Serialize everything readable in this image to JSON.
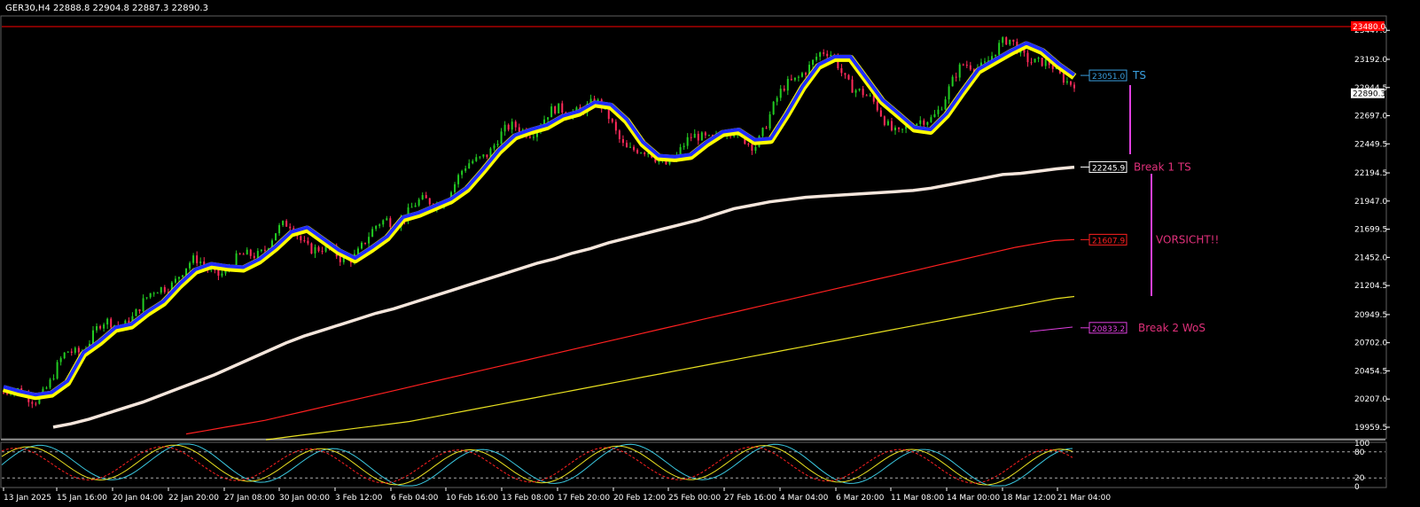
{
  "header": {
    "symbol_line": "GER30,H4  22888.8 22904.8 22887.3 22890.3"
  },
  "price_axis": {
    "ticks": [
      "23447.0",
      "23192.0",
      "22944.5",
      "22697.0",
      "22449.5",
      "22194.5",
      "21947.0",
      "21699.5",
      "21452.0",
      "21204.5",
      "20949.5",
      "20702.0",
      "20454.5",
      "20207.0",
      "19959.5"
    ],
    "current_price": "22890.3",
    "resistance_price": "23480.0"
  },
  "time_axis": {
    "ticks": [
      "13 Jan 2025",
      "15 Jan 16:00",
      "20 Jan 04:00",
      "22 Jan 20:00",
      "27 Jan 08:00",
      "30 Jan 00:00",
      "3 Feb 12:00",
      "6 Feb 04:00",
      "10 Feb 16:00",
      "13 Feb 08:00",
      "17 Feb 20:00",
      "20 Feb 12:00",
      "25 Feb 00:00",
      "27 Feb 16:00",
      "4 Mar 04:00",
      "6 Mar 20:00",
      "11 Mar 08:00",
      "14 Mar 00:00",
      "18 Mar 12:00",
      "21 Mar 04:00"
    ]
  },
  "oscillator_axis": {
    "ticks": [
      "100",
      "80",
      "20",
      "0"
    ]
  },
  "levels": [
    {
      "value": "23051.0",
      "label": "TS",
      "color": "#3aa0e0"
    },
    {
      "value": "22245.9",
      "label": "Break 1 TS",
      "color": "#ffffff",
      "label_color": "#e0307a"
    },
    {
      "value": "21607.9",
      "label": "VORSICHT!!",
      "color": "#ff2020",
      "label_color": "#e0307a"
    },
    {
      "value": "20833.2",
      "label": "Break 2 WoS",
      "color": "#e040e0",
      "label_color": "#e0307a"
    }
  ],
  "colors": {
    "background": "#000000",
    "bull_candle": "#22cc22",
    "bear_candle": "#ff2a5a",
    "ma_fast_outer": "#ffff00",
    "ma_fast_inner": "#1f2cff",
    "ma_mid": "#f5e6dc",
    "ma_slow": "#ff2020",
    "ma_slowest": "#e8e020",
    "resistance": "#ff0000",
    "separator": "#808080"
  },
  "chart_data": {
    "type": "line",
    "title": "GER30,H4",
    "series": [
      {
        "values": [
          20300,
          20260,
          20230,
          20250,
          20350,
          20600,
          20700,
          20820,
          20850,
          20960,
          21050,
          21200,
          21330,
          21380,
          21360,
          21350,
          21420,
          21530,
          21660,
          21700,
          21600,
          21500,
          21430,
          21520,
          21620,
          21790,
          21830,
          21890,
          21950,
          22050,
          22210,
          22380,
          22510,
          22560,
          22600,
          22680,
          22720,
          22800,
          22780,
          22650,
          22450,
          22330,
          22320,
          22340,
          22450,
          22540,
          22560,
          22470,
          22480,
          22700,
          22940,
          23130,
          23200,
          23200,
          23010,
          22820,
          22700,
          22580,
          22560,
          22700,
          22900,
          23090,
          23170,
          23250,
          23320,
          23260,
          23140,
          23040
        ]
      },
      {
        "values": [
          19960,
          19990,
          20030,
          20080,
          20130,
          20180,
          20240,
          20300,
          20360,
          20420,
          20490,
          20560,
          20630,
          20700,
          20760,
          20810,
          20860,
          20910,
          20960,
          21000,
          21050,
          21100,
          21150,
          21200,
          21250,
          21300,
          21350,
          21400,
          21440,
          21490,
          21530,
          21580,
          21620,
          21660,
          21700,
          21740,
          21780,
          21830,
          21880,
          21910,
          21940,
          21960,
          21980,
          21990,
          22000,
          22010,
          22020,
          22030,
          22040,
          22060,
          22090,
          22120,
          22150,
          22180,
          22190,
          22210,
          22230,
          22245
        ]
      },
      {
        "values": [
          19900,
          19930,
          19960,
          19990,
          20020,
          20060,
          20100,
          20140,
          20180,
          20220,
          20260,
          20300,
          20340,
          20380,
          20420,
          20460,
          20500,
          20540,
          20580,
          20620,
          20660,
          20700,
          20740,
          20780,
          20820,
          20860,
          20900,
          20940,
          20980,
          21020,
          21060,
          21100,
          21140,
          21180,
          21220,
          21260,
          21300,
          21340,
          21380,
          21420,
          21460,
          21500,
          21540,
          21570,
          21600,
          21608
        ]
      },
      {
        "values": [
          19850,
          19870,
          19890,
          19910,
          19930,
          19950,
          19970,
          19990,
          20010,
          20040,
          20070,
          20100,
          20130,
          20160,
          20190,
          20220,
          20250,
          20280,
          20310,
          20340,
          20370,
          20400,
          20430,
          20460,
          20490,
          20520,
          20550,
          20580,
          20610,
          20640,
          20670,
          20700,
          20730,
          20760,
          20790,
          20820,
          20850,
          20880,
          20910,
          20940,
          20970,
          21000,
          21030,
          21060,
          21090,
          21108
        ]
      }
    ],
    "ylim": [
      19959.5,
      23480.0
    ],
    "oscillator": {
      "ylim": [
        0,
        100
      ],
      "levels": [
        80,
        20
      ]
    }
  }
}
